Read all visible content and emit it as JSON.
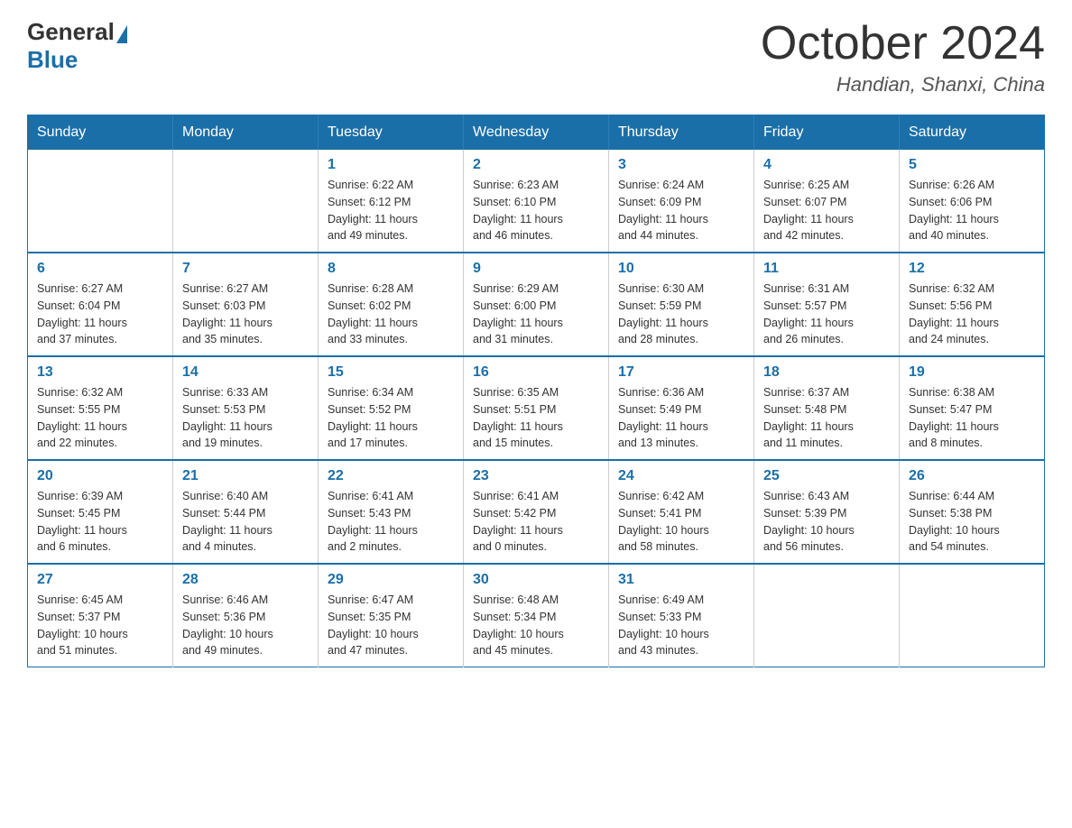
{
  "logo": {
    "general": "General",
    "blue": "Blue"
  },
  "title": "October 2024",
  "location": "Handian, Shanxi, China",
  "days_of_week": [
    "Sunday",
    "Monday",
    "Tuesday",
    "Wednesday",
    "Thursday",
    "Friday",
    "Saturday"
  ],
  "weeks": [
    [
      {
        "day": "",
        "info": ""
      },
      {
        "day": "",
        "info": ""
      },
      {
        "day": "1",
        "info": "Sunrise: 6:22 AM\nSunset: 6:12 PM\nDaylight: 11 hours\nand 49 minutes."
      },
      {
        "day": "2",
        "info": "Sunrise: 6:23 AM\nSunset: 6:10 PM\nDaylight: 11 hours\nand 46 minutes."
      },
      {
        "day": "3",
        "info": "Sunrise: 6:24 AM\nSunset: 6:09 PM\nDaylight: 11 hours\nand 44 minutes."
      },
      {
        "day": "4",
        "info": "Sunrise: 6:25 AM\nSunset: 6:07 PM\nDaylight: 11 hours\nand 42 minutes."
      },
      {
        "day": "5",
        "info": "Sunrise: 6:26 AM\nSunset: 6:06 PM\nDaylight: 11 hours\nand 40 minutes."
      }
    ],
    [
      {
        "day": "6",
        "info": "Sunrise: 6:27 AM\nSunset: 6:04 PM\nDaylight: 11 hours\nand 37 minutes."
      },
      {
        "day": "7",
        "info": "Sunrise: 6:27 AM\nSunset: 6:03 PM\nDaylight: 11 hours\nand 35 minutes."
      },
      {
        "day": "8",
        "info": "Sunrise: 6:28 AM\nSunset: 6:02 PM\nDaylight: 11 hours\nand 33 minutes."
      },
      {
        "day": "9",
        "info": "Sunrise: 6:29 AM\nSunset: 6:00 PM\nDaylight: 11 hours\nand 31 minutes."
      },
      {
        "day": "10",
        "info": "Sunrise: 6:30 AM\nSunset: 5:59 PM\nDaylight: 11 hours\nand 28 minutes."
      },
      {
        "day": "11",
        "info": "Sunrise: 6:31 AM\nSunset: 5:57 PM\nDaylight: 11 hours\nand 26 minutes."
      },
      {
        "day": "12",
        "info": "Sunrise: 6:32 AM\nSunset: 5:56 PM\nDaylight: 11 hours\nand 24 minutes."
      }
    ],
    [
      {
        "day": "13",
        "info": "Sunrise: 6:32 AM\nSunset: 5:55 PM\nDaylight: 11 hours\nand 22 minutes."
      },
      {
        "day": "14",
        "info": "Sunrise: 6:33 AM\nSunset: 5:53 PM\nDaylight: 11 hours\nand 19 minutes."
      },
      {
        "day": "15",
        "info": "Sunrise: 6:34 AM\nSunset: 5:52 PM\nDaylight: 11 hours\nand 17 minutes."
      },
      {
        "day": "16",
        "info": "Sunrise: 6:35 AM\nSunset: 5:51 PM\nDaylight: 11 hours\nand 15 minutes."
      },
      {
        "day": "17",
        "info": "Sunrise: 6:36 AM\nSunset: 5:49 PM\nDaylight: 11 hours\nand 13 minutes."
      },
      {
        "day": "18",
        "info": "Sunrise: 6:37 AM\nSunset: 5:48 PM\nDaylight: 11 hours\nand 11 minutes."
      },
      {
        "day": "19",
        "info": "Sunrise: 6:38 AM\nSunset: 5:47 PM\nDaylight: 11 hours\nand 8 minutes."
      }
    ],
    [
      {
        "day": "20",
        "info": "Sunrise: 6:39 AM\nSunset: 5:45 PM\nDaylight: 11 hours\nand 6 minutes."
      },
      {
        "day": "21",
        "info": "Sunrise: 6:40 AM\nSunset: 5:44 PM\nDaylight: 11 hours\nand 4 minutes."
      },
      {
        "day": "22",
        "info": "Sunrise: 6:41 AM\nSunset: 5:43 PM\nDaylight: 11 hours\nand 2 minutes."
      },
      {
        "day": "23",
        "info": "Sunrise: 6:41 AM\nSunset: 5:42 PM\nDaylight: 11 hours\nand 0 minutes."
      },
      {
        "day": "24",
        "info": "Sunrise: 6:42 AM\nSunset: 5:41 PM\nDaylight: 10 hours\nand 58 minutes."
      },
      {
        "day": "25",
        "info": "Sunrise: 6:43 AM\nSunset: 5:39 PM\nDaylight: 10 hours\nand 56 minutes."
      },
      {
        "day": "26",
        "info": "Sunrise: 6:44 AM\nSunset: 5:38 PM\nDaylight: 10 hours\nand 54 minutes."
      }
    ],
    [
      {
        "day": "27",
        "info": "Sunrise: 6:45 AM\nSunset: 5:37 PM\nDaylight: 10 hours\nand 51 minutes."
      },
      {
        "day": "28",
        "info": "Sunrise: 6:46 AM\nSunset: 5:36 PM\nDaylight: 10 hours\nand 49 minutes."
      },
      {
        "day": "29",
        "info": "Sunrise: 6:47 AM\nSunset: 5:35 PM\nDaylight: 10 hours\nand 47 minutes."
      },
      {
        "day": "30",
        "info": "Sunrise: 6:48 AM\nSunset: 5:34 PM\nDaylight: 10 hours\nand 45 minutes."
      },
      {
        "day": "31",
        "info": "Sunrise: 6:49 AM\nSunset: 5:33 PM\nDaylight: 10 hours\nand 43 minutes."
      },
      {
        "day": "",
        "info": ""
      },
      {
        "day": "",
        "info": ""
      }
    ]
  ]
}
